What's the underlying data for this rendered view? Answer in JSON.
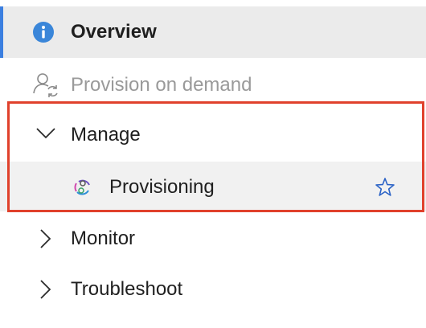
{
  "nav": {
    "items": [
      {
        "label": "Overview",
        "icon": "info-icon",
        "state": "selected"
      },
      {
        "label": "Provision on demand",
        "icon": "user-sync-icon",
        "state": "disabled"
      },
      {
        "label": "Manage",
        "icon": "chevron-down-icon",
        "state": "expanded"
      },
      {
        "label": "Provisioning",
        "icon": "provisioning-icon",
        "favorite_icon": "star-icon"
      },
      {
        "label": "Monitor",
        "icon": "chevron-right-icon",
        "state": "collapsed"
      },
      {
        "label": "Troubleshoot",
        "icon": "chevron-right-icon",
        "state": "collapsed"
      }
    ]
  },
  "colors": {
    "accent": "#3b7fe0",
    "info_icon": "#3a86d9",
    "highlight_border": "#e0412c",
    "selected_bg": "#ebebeb",
    "hover_bg": "#f1f1f1",
    "disabled_text": "#9a9a9a"
  }
}
